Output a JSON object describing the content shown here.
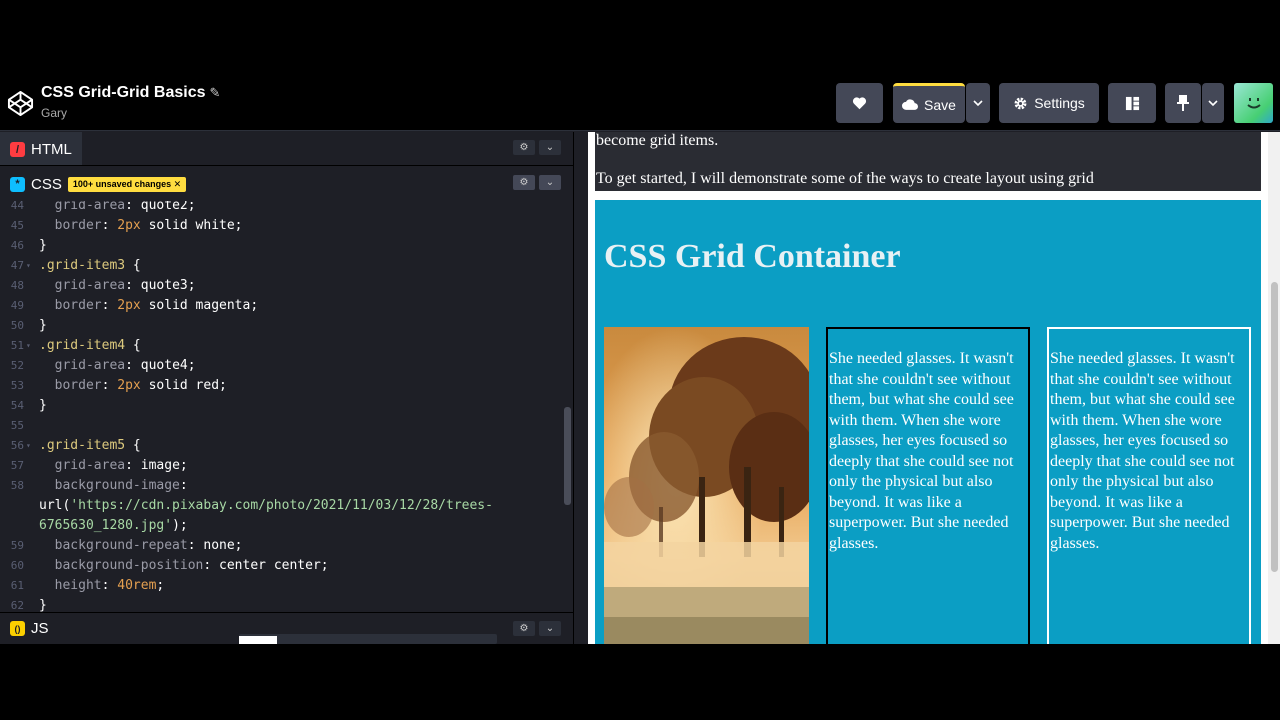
{
  "header": {
    "title": "CSS Grid-Grid Basics",
    "author": "Gary",
    "save_label": "Save",
    "settings_label": "Settings"
  },
  "editor": {
    "html_tab": "HTML",
    "css_tab": "CSS",
    "js_tab": "JS",
    "unsaved_badge": "100+ unsaved changes"
  },
  "code_lines": [
    {
      "n": "44",
      "text": "  grid-area: quote2;"
    },
    {
      "n": "45",
      "text": "  border: 2px solid white;"
    },
    {
      "n": "46",
      "text": "}"
    },
    {
      "n": "47",
      "text": ".grid-item3 {"
    },
    {
      "n": "48",
      "text": "  grid-area: quote3;"
    },
    {
      "n": "49",
      "text": "  border: 2px solid magenta;"
    },
    {
      "n": "50",
      "text": "}"
    },
    {
      "n": "51",
      "text": ".grid-item4 {"
    },
    {
      "n": "52",
      "text": "  grid-area: quote4;"
    },
    {
      "n": "53",
      "text": "  border: 2px solid red;"
    },
    {
      "n": "54",
      "text": "}"
    },
    {
      "n": "55",
      "text": ""
    },
    {
      "n": "56",
      "text": ".grid-item5 {"
    },
    {
      "n": "57",
      "text": "  grid-area: image;"
    },
    {
      "n": "58",
      "text": "  background-image:"
    },
    {
      "n": "",
      "text": "url('https://cdn.pixabay.com/photo/2021/11/03/12/28/trees-"
    },
    {
      "n": "",
      "text": "6765630_1280.jpg');"
    },
    {
      "n": "59",
      "text": "  background-repeat: none;"
    },
    {
      "n": "60",
      "text": "  background-position: center center;"
    },
    {
      "n": "61",
      "text": "  height: 40rem;"
    },
    {
      "n": "62",
      "text": "}"
    }
  ],
  "preview": {
    "intro_line1": "become grid items.",
    "intro_line2": "To get started, I will demonstrate some of the ways to create layout using grid",
    "container_title": "CSS Grid Container",
    "quote1": "She needed glasses. It wasn't that she couldn't see without them, but what she could see with them. When she wore glasses, her eyes focused so deeply that she could see not only the physical but also beyond. It was like a superpower. But she needed glasses.",
    "quote2": "She needed glasses. It wasn't that she couldn't see without them, but what she could see with them. When she wore glasses, her eyes focused so deeply that she could see not only the physical but also beyond. It was like a superpower. But she needed glasses."
  },
  "colors": {
    "accent_yellow": "#ffdd40",
    "html_icon": "#ff3c41",
    "css_icon": "#0ebeff",
    "js_icon": "#fcd000",
    "grid_container_bg": "#0b9ec4"
  }
}
